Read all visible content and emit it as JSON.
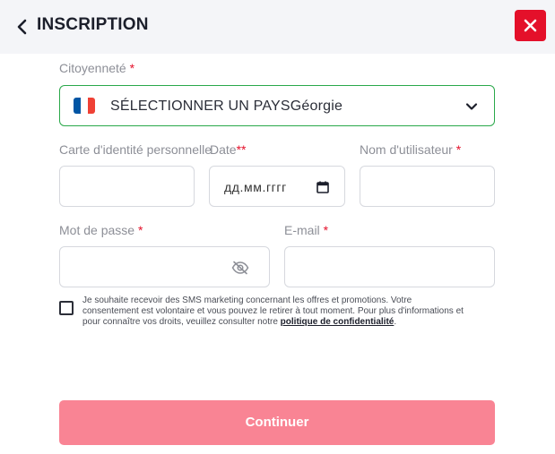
{
  "header": {
    "title": "INSCRIPTION",
    "back_icon": "chevron-left-icon",
    "close_icon": "close-icon"
  },
  "form": {
    "citizenship": {
      "label": "Citoyenneté",
      "required_mark": "*",
      "value": "SÉLECTIONNER UN PAYSGéorgie",
      "flag_colors": [
        "#0055a4",
        "#ffffff",
        "#ef4135"
      ]
    },
    "id_card": {
      "label": "Carte d'identité personnelle"
    },
    "date": {
      "label": "Date",
      "required_mark": "**",
      "placeholder": "дд.мм.гггг"
    },
    "username": {
      "label": "Nom d'utilisateur",
      "required_mark": "*"
    },
    "password": {
      "label": "Mot de passe",
      "required_mark": "*"
    },
    "email": {
      "label": "E-mail",
      "required_mark": "*"
    },
    "consent": {
      "text": "Je souhaite recevoir des SMS marketing concernant les offres et promotions. Votre consentement est volontaire et vous pouvez le retirer à tout moment. Pour plus d'informations et pour connaître vos droits, veuillez consulter notre ",
      "link": "politique de confidentialité",
      "end": ".",
      "checked": false
    },
    "submit_label": "Continuer"
  },
  "colors": {
    "accent_red": "#e4102a",
    "valid_green": "#2aa84a",
    "submit_bg": "#f98494"
  }
}
